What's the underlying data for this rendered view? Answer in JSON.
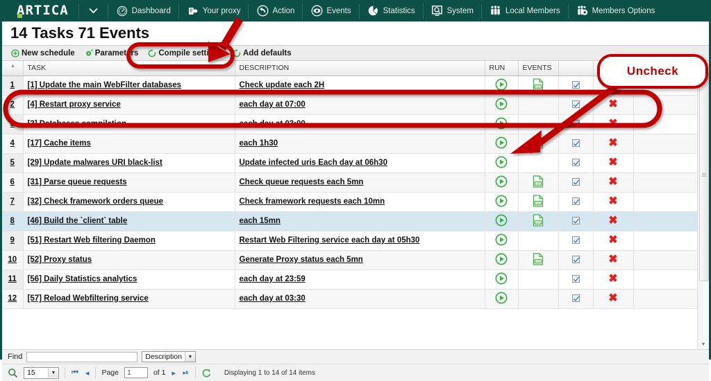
{
  "nav": {
    "logo": "ARTICA",
    "caret": "⌄",
    "items": [
      {
        "label": "Dashboard",
        "icon": "gauge-icon"
      },
      {
        "label": "Your proxy",
        "icon": "proxy-icon"
      },
      {
        "label": "Action",
        "icon": "back-arrow-icon"
      },
      {
        "label": "Events",
        "icon": "eye-icon"
      },
      {
        "label": "Statistics",
        "icon": "pie-chart-icon"
      },
      {
        "label": "System",
        "icon": "monitor-search-icon"
      },
      {
        "label": "Local Members",
        "icon": "people-icon"
      },
      {
        "label": "Members Options",
        "icon": "people-gear-icon"
      }
    ]
  },
  "page": {
    "title": "14 Tasks 71 Events"
  },
  "toolbar": {
    "items": [
      {
        "label": "New schedule",
        "icon": "plus-circle-icon"
      },
      {
        "label": "Parameters",
        "icon": "gear-icon"
      },
      {
        "label": "Compile settings",
        "icon": "refresh-icon"
      },
      {
        "label": "Add defaults",
        "icon": "refresh-icon"
      }
    ]
  },
  "grid": {
    "columns": [
      "TASK",
      "DESCRIPTION",
      "RUN",
      "EVENTS",
      "",
      ""
    ],
    "rows": [
      {
        "n": "1",
        "task": "[1] Update the main WebFilter databases",
        "desc": "Check update each 2H",
        "run": true,
        "events": true,
        "checked": true,
        "delete": true
      },
      {
        "n": "2",
        "task": "[4] Restart proxy service",
        "desc": "each day at 07:00",
        "run": true,
        "events": false,
        "checked": true,
        "delete": true
      },
      {
        "n": "3",
        "task": "[3] Databases compilation",
        "desc": "each day at 03:00",
        "run": true,
        "events": false,
        "checked": true,
        "delete": true
      },
      {
        "n": "4",
        "task": "[17] Cache items",
        "desc": "each 1h30",
        "run": true,
        "events": true,
        "checked": true,
        "delete": true
      },
      {
        "n": "5",
        "task": "[29] Update malwares URI black-list",
        "desc": "Update infected uris Each day at 06h30",
        "run": true,
        "events": false,
        "checked": true,
        "delete": true
      },
      {
        "n": "6",
        "task": "[31] Parse queue requests",
        "desc": "Check queue requests each 5mn",
        "run": true,
        "events": true,
        "checked": true,
        "delete": true
      },
      {
        "n": "7",
        "task": "[32] Check framework orders queue",
        "desc": "Check framework requests each 10mn",
        "run": true,
        "events": true,
        "checked": true,
        "delete": true
      },
      {
        "n": "8",
        "task": "[46] Build the `client` table",
        "desc": "each 15mn",
        "run": true,
        "events": true,
        "checked": true,
        "delete": true,
        "selected": true
      },
      {
        "n": "9",
        "task": "[51] Restart Web filtering Daemon",
        "desc": "Restart Web Filtering service each day at 05h30",
        "run": true,
        "events": false,
        "checked": true,
        "delete": true
      },
      {
        "n": "10",
        "task": "[52] Proxy status",
        "desc": "Generate Proxy status each 5mn",
        "run": true,
        "events": true,
        "checked": true,
        "delete": true
      },
      {
        "n": "11",
        "task": "[56] Daily Statistics analytics",
        "desc": "each day at 23:59",
        "run": true,
        "events": false,
        "checked": true,
        "delete": true
      },
      {
        "n": "12",
        "task": "[57] Reload Webfiltering service",
        "desc": "each day at 03:30",
        "run": true,
        "events": false,
        "checked": true,
        "delete": true
      }
    ]
  },
  "find": {
    "label": "Find",
    "value": "",
    "placeholder": "",
    "filter_selected": "Description"
  },
  "pager": {
    "page_size": "15",
    "page_label": "Page",
    "page_value": "1",
    "of_label": "of 1",
    "status": "Displaying 1 to 14 of 14 items",
    "first_icon": "first-page-icon",
    "prev_icon": "prev-page-icon",
    "next_icon": "next-page-icon",
    "last_icon": "last-page-icon",
    "refresh_icon": "refresh-icon",
    "search_icon": "search-icon"
  },
  "annotations": {
    "callout_label": "Uncheck",
    "accent": "#c00000"
  },
  "colors": {
    "nav_bg": "#0d5047",
    "accent_green": "#2eaa3c",
    "delete_red": "#e02020",
    "selected_row": "#d6e7f2"
  }
}
